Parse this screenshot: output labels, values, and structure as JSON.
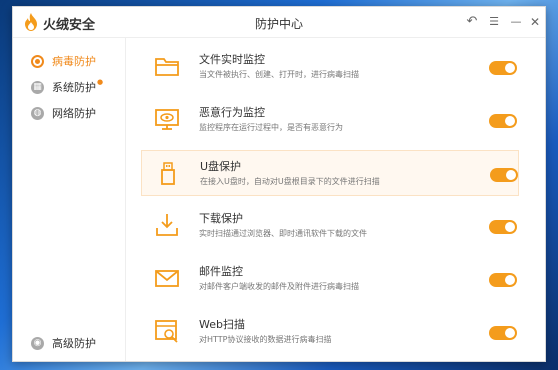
{
  "app": {
    "name": "火绒安全",
    "window_title": "防护中心"
  },
  "window_controls": {
    "back": "↶",
    "menu": "☰",
    "minimize": "—",
    "close": "✕"
  },
  "sidebar": {
    "items": [
      {
        "label": "病毒防护",
        "icon": "virus-shield-icon"
      },
      {
        "label": "系统防护",
        "icon": "system-grid-icon"
      },
      {
        "label": "网络防护",
        "icon": "globe-icon"
      },
      {
        "label": "高级防护",
        "icon": "advanced-shield-icon"
      }
    ]
  },
  "protections": [
    {
      "title": "文件实时监控",
      "desc": "当文件被执行、创建、打开时，进行病毒扫描",
      "icon": "folder-icon",
      "enabled": true
    },
    {
      "title": "恶意行为监控",
      "desc": "监控程序在运行过程中，是否有恶意行为",
      "icon": "monitor-eye-icon",
      "enabled": true
    },
    {
      "title": "U盘保护",
      "desc": "在接入U盘时，自动对U盘根目录下的文件进行扫描",
      "icon": "usb-drive-icon",
      "enabled": true
    },
    {
      "title": "下载保护",
      "desc": "实时扫描通过浏览器、即时通讯软件下载的文件",
      "icon": "download-tray-icon",
      "enabled": true
    },
    {
      "title": "邮件监控",
      "desc": "对邮件客户端收发的邮件及附件进行病毒扫描",
      "icon": "mail-icon",
      "enabled": true
    },
    {
      "title": "Web扫描",
      "desc": "对HTTP协议接收的数据进行病毒扫描",
      "icon": "web-scan-icon",
      "enabled": true
    }
  ],
  "colors": {
    "accent": "#f49c1c",
    "active_text": "#f08a1c"
  }
}
